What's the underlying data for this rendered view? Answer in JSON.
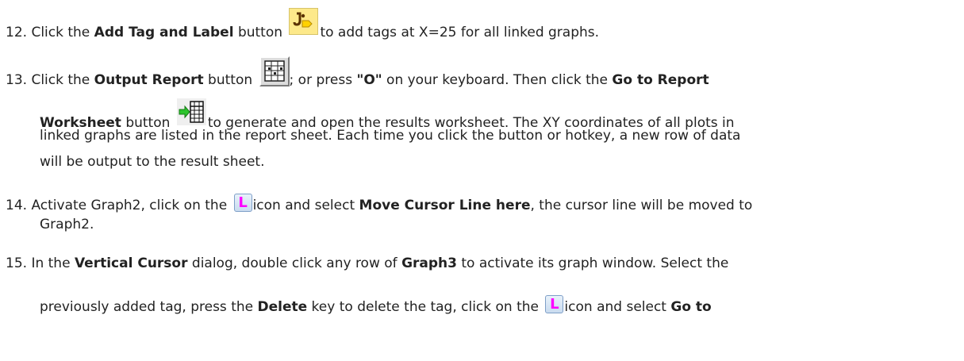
{
  "steps": [
    {
      "number": "12.",
      "lines": [
        {
          "t1": "Click the ",
          "b1": "Add Tag and Label",
          "t2": " button ",
          "t3": "to add tags at X=25 for all linked graphs."
        }
      ]
    },
    {
      "number": "13.",
      "line1": {
        "t1": "Click the ",
        "b1": "Output Report",
        "t2": " button ",
        "t3": "; or press ",
        "b2": "\"O\"",
        "t4": " on your keyboard. Then click the ",
        "b3": "Go to Report"
      },
      "line2": {
        "b1": "Worksheet",
        "t1": " button ",
        "t2": "to generate and open the results worksheet. The XY coordinates of all plots in"
      },
      "line3": "linked graphs are listed in the report sheet. Each time you click the button or hotkey, a new row of data",
      "line4": "will be output to the result sheet."
    },
    {
      "number": "14.",
      "line1": {
        "t1": "Activate Graph2, click on the ",
        "t2": "icon and select ",
        "b1": "Move Cursor Line here",
        "t3": ", the cursor line will be moved to"
      },
      "line2": "Graph2."
    },
    {
      "number": "15.",
      "line1": {
        "t1": "In the ",
        "b1": "Vertical Cursor",
        "t2": " dialog, double click any row of ",
        "b2": "Graph3",
        "t3": " to activate its graph window. Select the"
      },
      "line2": {
        "t1": "previously added tag, press the ",
        "b1": "Delete",
        "t2": " key to delete the tag, click on the ",
        "t3": "icon and select ",
        "b2": "Go to"
      }
    }
  ],
  "icons": {
    "add_tag": "add-tag-label-icon",
    "output_report": "output-report-icon",
    "report_sheet": "go-to-report-worksheet-icon",
    "cursor_L": "L",
    "cursor_L_color": "#ff00ff"
  }
}
